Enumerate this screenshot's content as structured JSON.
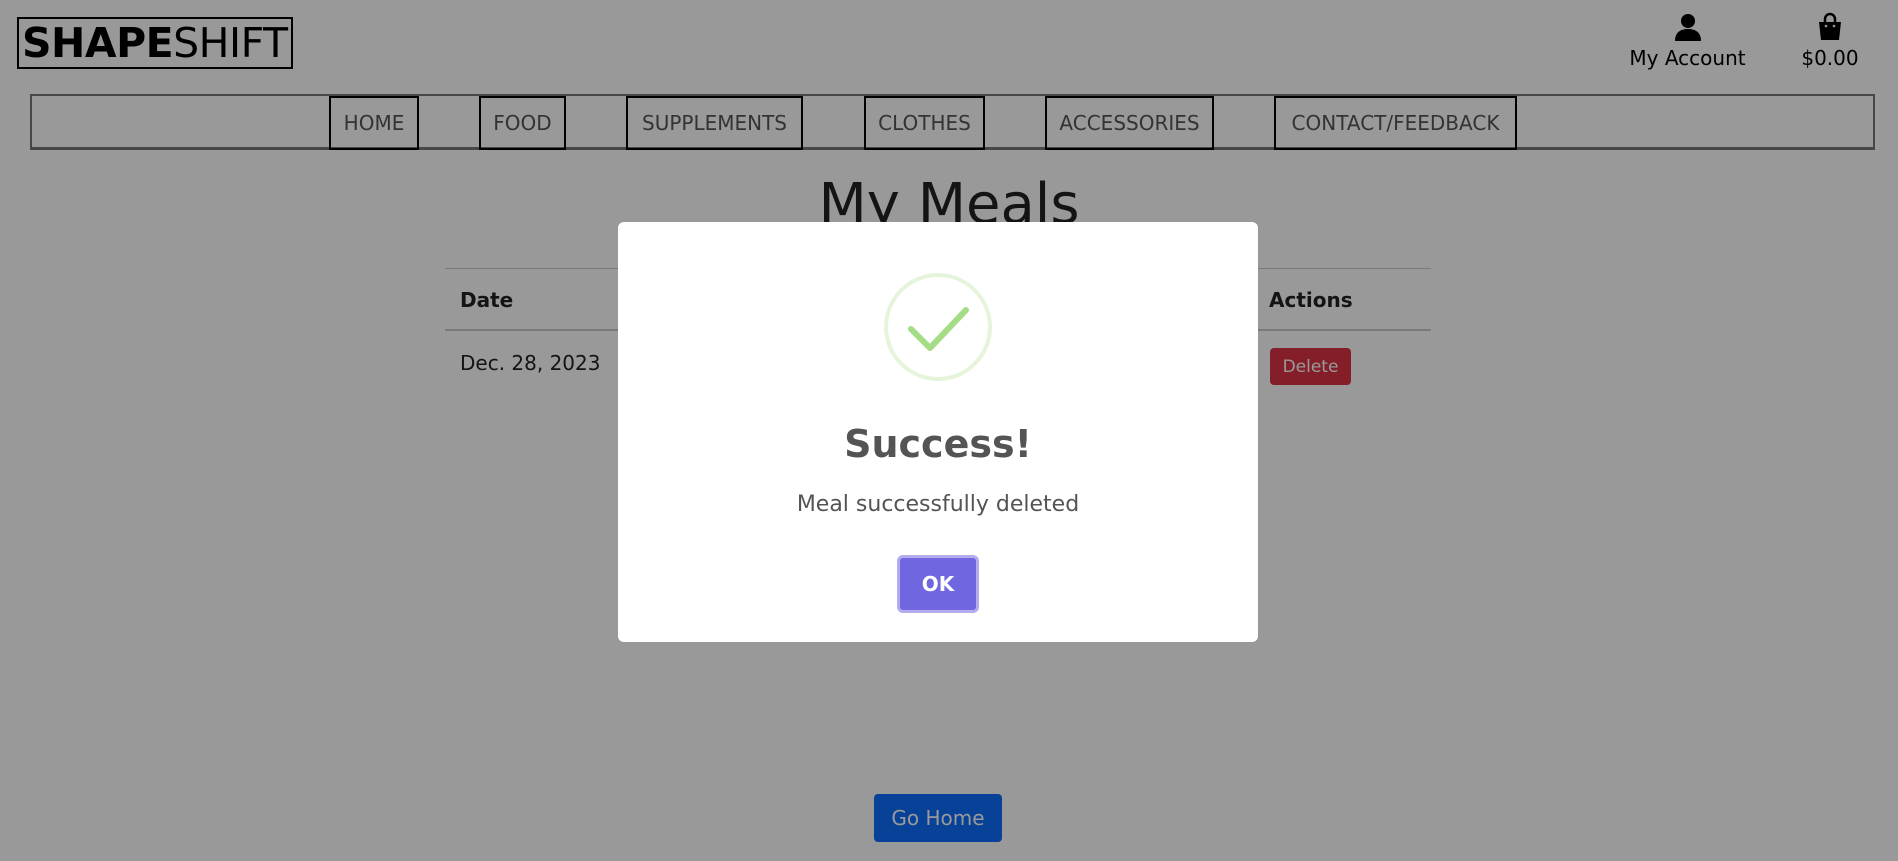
{
  "header": {
    "logo_bold": "SHAPE",
    "logo_light": "SHIFT",
    "account_label": "My Account",
    "account_icon": "user-icon",
    "bag_total": "$0.00",
    "bag_icon": "shopping-bag-icon"
  },
  "nav": {
    "items": [
      {
        "label": "HOME"
      },
      {
        "label": "FOOD"
      },
      {
        "label": "SUPPLEMENTS"
      },
      {
        "label": "CLOTHES"
      },
      {
        "label": "ACCESSORIES"
      },
      {
        "label": "CONTACT/FEEDBACK"
      }
    ]
  },
  "main": {
    "title": "My Meals",
    "table": {
      "headers": {
        "date": "Date",
        "actions": "Actions"
      },
      "rows": [
        {
          "date": "Dec. 28, 2023",
          "action": "Delete"
        }
      ]
    },
    "go_home": "Go Home"
  },
  "modal": {
    "icon": "success-check-icon",
    "title": "Success!",
    "message": "Meal successfully deleted",
    "ok_label": "OK"
  },
  "colors": {
    "success_icon": "#a5dc86",
    "ok_button": "#7066e0",
    "delete_button": "#dc3545",
    "go_home_button": "#0d6efd"
  }
}
